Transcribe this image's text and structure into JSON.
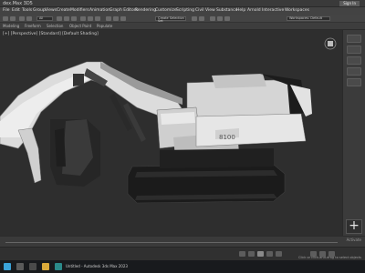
{
  "app": {
    "title": "dex.Max 3D5",
    "signin_label": "Sign In"
  },
  "menu": {
    "items": [
      "File",
      "Edit",
      "Tools",
      "Group",
      "Views",
      "Create",
      "Modifiers",
      "Animation",
      "Graph Editors",
      "Rendering",
      "Customize",
      "Scripting",
      "Civil View",
      "Substance",
      "Help",
      "Arnold",
      "Interactive",
      "Workspaces"
    ]
  },
  "toolbar": {
    "selection_filter": "All",
    "named_selection": "Create Selection Set",
    "workspace": "Workspaces: Default"
  },
  "ribbon": {
    "tabs": [
      "Modeling",
      "Freeform",
      "Selection",
      "Object Paint",
      "Populate"
    ]
  },
  "viewport": {
    "label": "[+] [Perspective] [Standard] [Default Shading]",
    "model_label": "8100"
  },
  "timeline": {
    "activate_text": "Activate"
  },
  "status": {
    "hint_text": "Click or click-and-drag to select objects"
  },
  "taskbar": {
    "app_label": "Untitled - Autodesk 3ds Max 2023"
  },
  "colors": {
    "accent": "#3aa2d8",
    "viewport_bg": "#2e2e2e",
    "model_light": "#d9d9d9",
    "model_dark": "#1c1c1c"
  }
}
